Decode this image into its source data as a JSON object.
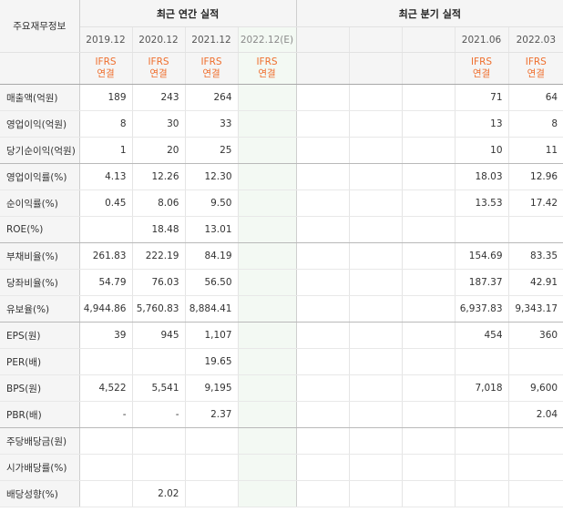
{
  "header": {
    "row_label": "주요재무정보",
    "annual_title": "최근 연간 실적",
    "quarter_title": "최근 분기 실적",
    "annual_periods": [
      "2019.12",
      "2020.12",
      "2021.12",
      "2022.12(E)"
    ],
    "quarter_periods": [
      "",
      "",
      "",
      "2021.06",
      "2022.03"
    ],
    "accounting_top": "IFRS",
    "accounting_bottom": "연결"
  },
  "rows": [
    {
      "label": "매출액(억원)",
      "annual": [
        "189",
        "243",
        "264",
        ""
      ],
      "quarter": [
        "",
        "",
        "",
        "71",
        "64"
      ]
    },
    {
      "label": "영업이익(억원)",
      "annual": [
        "8",
        "30",
        "33",
        ""
      ],
      "quarter": [
        "",
        "",
        "",
        "13",
        "8"
      ]
    },
    {
      "label": "당기순이익(억원)",
      "annual": [
        "1",
        "20",
        "25",
        ""
      ],
      "quarter": [
        "",
        "",
        "",
        "10",
        "11"
      ]
    },
    {
      "label": "영업이익률(%)",
      "annual": [
        "4.13",
        "12.26",
        "12.30",
        ""
      ],
      "quarter": [
        "",
        "",
        "",
        "18.03",
        "12.96"
      ]
    },
    {
      "label": "순이익률(%)",
      "annual": [
        "0.45",
        "8.06",
        "9.50",
        ""
      ],
      "quarter": [
        "",
        "",
        "",
        "13.53",
        "17.42"
      ]
    },
    {
      "label": "ROE(%)",
      "annual": [
        "",
        "18.48",
        "13.01",
        ""
      ],
      "quarter": [
        "",
        "",
        "",
        "",
        ""
      ]
    },
    {
      "label": "부채비율(%)",
      "annual": [
        "261.83",
        "222.19",
        "84.19",
        ""
      ],
      "quarter": [
        "",
        "",
        "",
        "154.69",
        "83.35"
      ]
    },
    {
      "label": "당좌비율(%)",
      "annual": [
        "54.79",
        "76.03",
        "56.50",
        ""
      ],
      "quarter": [
        "",
        "",
        "",
        "187.37",
        "42.91"
      ]
    },
    {
      "label": "유보율(%)",
      "annual": [
        "4,944.86",
        "5,760.83",
        "8,884.41",
        ""
      ],
      "quarter": [
        "",
        "",
        "",
        "6,937.83",
        "9,343.17"
      ]
    },
    {
      "label": "EPS(원)",
      "annual": [
        "39",
        "945",
        "1,107",
        ""
      ],
      "quarter": [
        "",
        "",
        "",
        "454",
        "360"
      ]
    },
    {
      "label": "PER(배)",
      "annual": [
        "",
        "",
        "19.65",
        ""
      ],
      "quarter": [
        "",
        "",
        "",
        "",
        ""
      ]
    },
    {
      "label": "BPS(원)",
      "annual": [
        "4,522",
        "5,541",
        "9,195",
        ""
      ],
      "quarter": [
        "",
        "",
        "",
        "7,018",
        "9,600"
      ]
    },
    {
      "label": "PBR(배)",
      "annual": [
        "-",
        "-",
        "2.37",
        ""
      ],
      "quarter": [
        "",
        "",
        "",
        "",
        "2.04"
      ]
    },
    {
      "label": "주당배당금(원)",
      "annual": [
        "",
        "",
        "",
        ""
      ],
      "quarter": [
        "",
        "",
        "",
        "",
        ""
      ]
    },
    {
      "label": "시가배당률(%)",
      "annual": [
        "",
        "",
        "",
        ""
      ],
      "quarter": [
        "",
        "",
        "",
        "",
        ""
      ]
    },
    {
      "label": "배당성향(%)",
      "annual": [
        "",
        "2.02",
        "",
        ""
      ],
      "quarter": [
        "",
        "",
        "",
        "",
        ""
      ]
    }
  ],
  "colors": {
    "ifrs": "#ef6f2e",
    "estimate_bg": "#f3f9f3",
    "header_bg": "#f5f5f5"
  }
}
